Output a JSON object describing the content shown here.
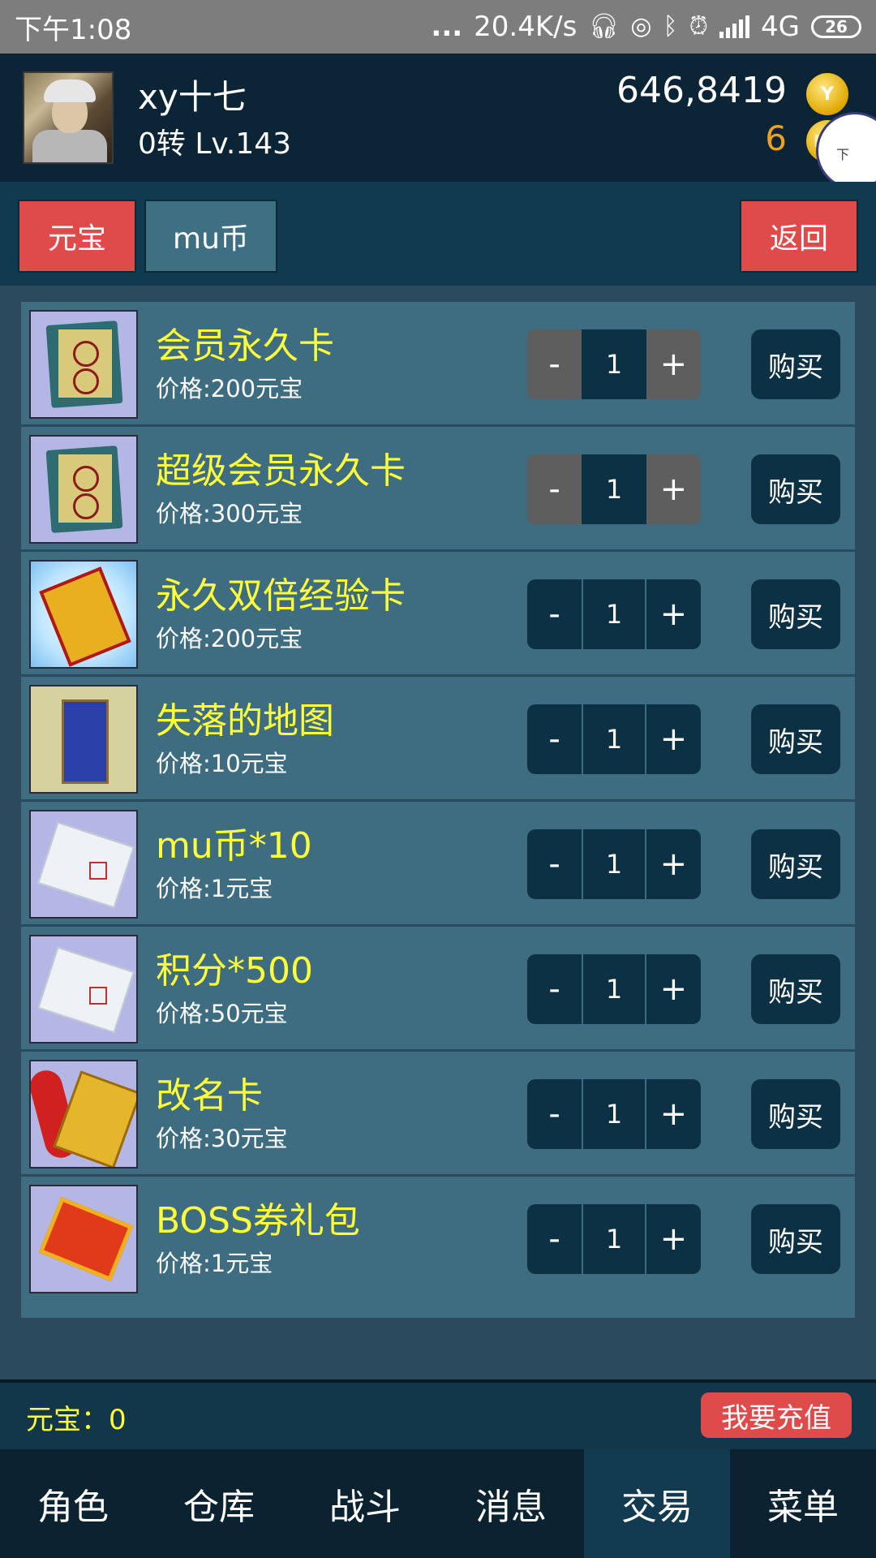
{
  "status_bar": {
    "time": "下午1:08",
    "dots": "...",
    "speed": "20.4K/s",
    "network": "4G",
    "battery": "26"
  },
  "player": {
    "name": "xy十七",
    "level": "0转 Lv.143",
    "gold": "646,8419",
    "mu_coins": "6",
    "mu_coin_glyph": "Mu",
    "gold_coin_glyph": "Y"
  },
  "float_widget": {
    "text": "下"
  },
  "tabs": {
    "yuanbao": "元宝",
    "mu": "mu币",
    "back": "返回"
  },
  "items": [
    {
      "name": "会员永久卡",
      "price": "价格:200元宝",
      "qty": "1",
      "minus": "-",
      "plus": "+",
      "buy": "购买",
      "icon": "vip-card-icon"
    },
    {
      "name": "超级会员永久卡",
      "price": "价格:300元宝",
      "qty": "1",
      "minus": "-",
      "plus": "+",
      "buy": "购买",
      "icon": "super-vip-card-icon"
    },
    {
      "name": "永久双倍经验卡",
      "price": "价格:200元宝",
      "qty": "1",
      "minus": "-",
      "plus": "+",
      "buy": "购买",
      "icon": "double-exp-card-icon"
    },
    {
      "name": "失落的地图",
      "price": "价格:10元宝",
      "qty": "1",
      "minus": "-",
      "plus": "+",
      "buy": "购买",
      "icon": "lost-map-icon"
    },
    {
      "name": "mu币*10",
      "price": "价格:1元宝",
      "qty": "1",
      "minus": "-",
      "plus": "+",
      "buy": "购买",
      "icon": "mu-coin-note-icon"
    },
    {
      "name": "积分*500",
      "price": "价格:50元宝",
      "qty": "1",
      "minus": "-",
      "plus": "+",
      "buy": "购买",
      "icon": "points-note-icon"
    },
    {
      "name": "改名卡",
      "price": "价格:30元宝",
      "qty": "1",
      "minus": "-",
      "plus": "+",
      "buy": "购买",
      "icon": "rename-card-icon"
    },
    {
      "name": "BOSS券礼包",
      "price": "价格:1元宝",
      "qty": "1",
      "minus": "-",
      "plus": "+",
      "buy": "购买",
      "icon": "boss-ticket-icon"
    }
  ],
  "footer": {
    "balance": "元宝：0",
    "recharge": "我要充值"
  },
  "nav": [
    {
      "label": "角色"
    },
    {
      "label": "仓库"
    },
    {
      "label": "战斗"
    },
    {
      "label": "消息"
    },
    {
      "label": "交易",
      "active": true
    },
    {
      "label": "菜单"
    }
  ],
  "colors": {
    "accent_red": "#df4b4b",
    "item_name_yellow": "#ffff3a",
    "mu_orange": "#f0a020",
    "panel": "#3e6c80",
    "dark": "#0d3144"
  }
}
